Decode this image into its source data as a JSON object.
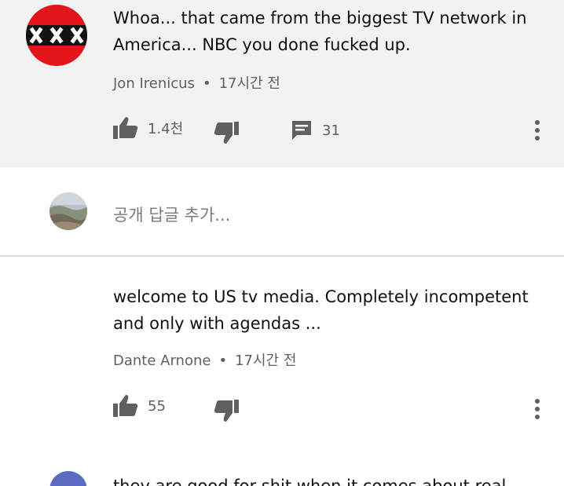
{
  "comments": [
    {
      "text": "Whoa... that came from the biggest TV network in America... NBC you done fucked up.",
      "author": "Jon Irenicus",
      "time": "17시간 전",
      "likes": "1.4천",
      "replies": "31"
    },
    {
      "text": "welcome to US tv media. Completely incompetent and only with agendas ...",
      "author": "Dante Arnone",
      "time": "17시간 전",
      "likes": "55"
    },
    {
      "text": "they are good for shit when it comes about real"
    }
  ],
  "reply_box": {
    "placeholder": "공개 답글 추가..."
  },
  "meta_separator": "•",
  "icons": {
    "like": "thumbs-up-icon",
    "dislike": "thumbs-down-icon",
    "reply": "comment-icon",
    "more": "more-vertical-icon"
  },
  "colors": {
    "top_comment_bg": "#f2f2f2",
    "avatar1_red": "#e3151a",
    "avatar_next": "#5c6bc0",
    "secondary_text": "#606060"
  }
}
